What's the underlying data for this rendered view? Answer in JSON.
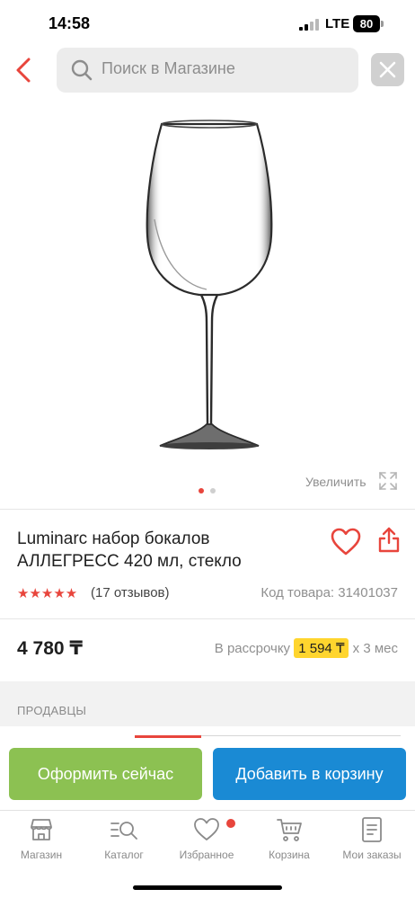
{
  "status_bar": {
    "time": "14:58",
    "network": "LTE",
    "battery": "80"
  },
  "header": {
    "back_icon": "chevron-left-icon",
    "search_placeholder": "Поиск в Магазине",
    "search_icon": "search-icon",
    "clear_icon": "close-icon"
  },
  "gallery": {
    "zoom_label": "Увеличить",
    "zoom_icon": "expand-icon",
    "page_count": 2,
    "current_page": 1
  },
  "product": {
    "title": "Luminarc набор бокалов АЛЛЕГРЕСС 420 мл, стекло",
    "rating_stars": "★★★★★",
    "rating": 5,
    "reviews": "(17 отзывов)",
    "sku": "Код товара: 31401037",
    "price": "4 780 ₸",
    "installment_prefix": "В рассрочку",
    "installment_amount": "1 594 ₸",
    "installment_suffix": "х 3 мес"
  },
  "sellers": {
    "title": "ПРОДАВЦЫ"
  },
  "actions": {
    "checkout_label": "Оформить сейчас",
    "add_to_cart_label": "Добавить в корзину"
  },
  "tabbar": {
    "items": [
      {
        "label": "Магазин",
        "icon": "store-icon"
      },
      {
        "label": "Каталог",
        "icon": "catalog-search-icon"
      },
      {
        "label": "Избранное",
        "icon": "heart-icon"
      },
      {
        "label": "Корзина",
        "icon": "cart-icon"
      },
      {
        "label": "Мои заказы",
        "icon": "orders-icon"
      }
    ]
  },
  "colors": {
    "accent_red": "#e8453c",
    "checkout_green": "#8cc152",
    "cart_blue": "#1a8ad4",
    "installment_yellow": "#ffd52e"
  }
}
